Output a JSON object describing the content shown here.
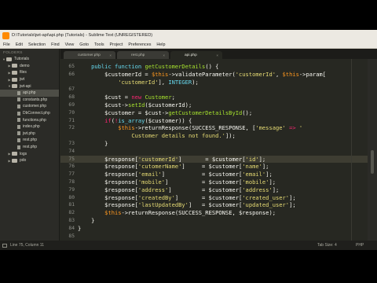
{
  "window": {
    "title": "D:\\Tutorials\\jwt-api\\api.php (Tutorials) - Sublime Text (UNREGISTERED)"
  },
  "menu": [
    "File",
    "Edit",
    "Selection",
    "Find",
    "View",
    "Goto",
    "Tools",
    "Project",
    "Preferences",
    "Help"
  ],
  "sidebar": {
    "header": "FOLDERS",
    "items": [
      {
        "label": "Tutorials",
        "type": "folder",
        "depth": 0,
        "arrow": "▼"
      },
      {
        "label": "demo",
        "type": "folder",
        "depth": 1,
        "arrow": "▶"
      },
      {
        "label": "files",
        "type": "folder",
        "depth": 1,
        "arrow": "▶"
      },
      {
        "label": "jwt",
        "type": "folder",
        "depth": 1,
        "arrow": "▶"
      },
      {
        "label": "jwt-api",
        "type": "folder",
        "depth": 1,
        "arrow": "▼"
      },
      {
        "label": "api.php",
        "type": "file",
        "depth": 2,
        "selected": true
      },
      {
        "label": "constants.php",
        "type": "file",
        "depth": 2
      },
      {
        "label": "customer.php",
        "type": "file",
        "depth": 2
      },
      {
        "label": "DbConnect.php",
        "type": "file",
        "depth": 2
      },
      {
        "label": "functions.php",
        "type": "file",
        "depth": 2
      },
      {
        "label": "index.php",
        "type": "file",
        "depth": 2
      },
      {
        "label": "jwt.php",
        "type": "file",
        "depth": 2
      },
      {
        "label": "rest.php",
        "type": "file",
        "depth": 2
      },
      {
        "label": "rest.php",
        "type": "file",
        "depth": 2
      },
      {
        "label": "logs",
        "type": "folder",
        "depth": 1,
        "arrow": "▶"
      },
      {
        "label": "pdo",
        "type": "folder",
        "depth": 1,
        "arrow": "▶"
      }
    ]
  },
  "tabs": [
    {
      "label": "customer.php",
      "active": false,
      "close": "×"
    },
    {
      "label": "rest.php",
      "active": false,
      "close": "×"
    },
    {
      "label": "api.php",
      "active": true,
      "close": "×"
    }
  ],
  "editor": {
    "colors": {
      "background": "#272822",
      "keyword": "#66d9ef",
      "storage": "#f92672",
      "function": "#a6e22e",
      "string": "#e6db74",
      "this": "#fd971f",
      "default": "#f8f8f2"
    },
    "lines": [
      {
        "n": "65",
        "tokens": [
          [
            "    ",
            "d"
          ],
          [
            "public",
            "k"
          ],
          [
            " ",
            "d"
          ],
          [
            "function",
            "k"
          ],
          [
            " ",
            "d"
          ],
          [
            "getCustomerDetails",
            "f"
          ],
          [
            "() {",
            "d"
          ]
        ]
      },
      {
        "n": "66",
        "tokens": [
          [
            "        $customerId = ",
            "d"
          ],
          [
            "$this",
            "t"
          ],
          [
            "->validateParameter(",
            "d"
          ],
          [
            "'customerId'",
            "s"
          ],
          [
            ", ",
            "d"
          ],
          [
            "$this",
            "t"
          ],
          [
            "->param[",
            "d"
          ]
        ]
      },
      {
        "n": "",
        "tokens": [
          [
            "            ",
            "d"
          ],
          [
            "'customerId'",
            "s"
          ],
          [
            "], ",
            "d"
          ],
          [
            "INTEGER",
            "k"
          ],
          [
            ");",
            "d"
          ]
        ]
      },
      {
        "n": "67",
        "tokens": []
      },
      {
        "n": "68",
        "tokens": [
          [
            "        $cust = ",
            "d"
          ],
          [
            "new",
            "p"
          ],
          [
            " ",
            "d"
          ],
          [
            "Customer",
            "f"
          ],
          [
            ";",
            "d"
          ]
        ]
      },
      {
        "n": "69",
        "tokens": [
          [
            "        $cust->",
            "d"
          ],
          [
            "setId",
            "f"
          ],
          [
            "($customerId);",
            "d"
          ]
        ]
      },
      {
        "n": "70",
        "tokens": [
          [
            "        $customer = $cust->",
            "d"
          ],
          [
            "getCustomerDetailsById",
            "f"
          ],
          [
            "();",
            "d"
          ]
        ]
      },
      {
        "n": "71",
        "tokens": [
          [
            "        ",
            "d"
          ],
          [
            "if",
            "p"
          ],
          [
            "(",
            "d"
          ],
          [
            "!",
            "p"
          ],
          [
            "is_array",
            "k"
          ],
          [
            "($customer)) {",
            "d"
          ]
        ]
      },
      {
        "n": "72",
        "tokens": [
          [
            "            ",
            "d"
          ],
          [
            "$this",
            "t"
          ],
          [
            "->returnResponse(SUCCESS_RESPONSE, [",
            "d"
          ],
          [
            "'message'",
            "s"
          ],
          [
            " => ",
            "p"
          ],
          [
            "'",
            "s"
          ]
        ]
      },
      {
        "n": "",
        "tokens": [
          [
            "                ",
            "d"
          ],
          [
            "Customer details not found.'",
            "s"
          ],
          [
            "]);",
            "d"
          ]
        ]
      },
      {
        "n": "73",
        "tokens": [
          [
            "        }",
            "d"
          ]
        ]
      },
      {
        "n": "74",
        "tokens": []
      },
      {
        "n": "75",
        "tokens": [
          [
            "        $response[",
            "d"
          ],
          [
            "'customerId'",
            "s"
          ],
          [
            "]       = $customer[",
            "d"
          ],
          [
            "'id'",
            "s"
          ],
          [
            "];",
            "d"
          ]
        ]
      },
      {
        "n": "76",
        "tokens": [
          [
            "        $response[",
            "d"
          ],
          [
            "'cutomerName'",
            "s"
          ],
          [
            "]     = $customer[",
            "d"
          ],
          [
            "'name'",
            "s"
          ],
          [
            "];",
            "d"
          ]
        ]
      },
      {
        "n": "77",
        "tokens": [
          [
            "        $response[",
            "d"
          ],
          [
            "'email'",
            "s"
          ],
          [
            "]           = $customer[",
            "d"
          ],
          [
            "'email'",
            "s"
          ],
          [
            "];",
            "d"
          ]
        ]
      },
      {
        "n": "78",
        "tokens": [
          [
            "        $response[",
            "d"
          ],
          [
            "'mobile'",
            "s"
          ],
          [
            "]          = $customer[",
            "d"
          ],
          [
            "'mobile'",
            "s"
          ],
          [
            "];",
            "d"
          ]
        ]
      },
      {
        "n": "79",
        "tokens": [
          [
            "        $response[",
            "d"
          ],
          [
            "'address'",
            "s"
          ],
          [
            "]         = $customer[",
            "d"
          ],
          [
            "'address'",
            "s"
          ],
          [
            "];",
            "d"
          ]
        ]
      },
      {
        "n": "80",
        "tokens": [
          [
            "        $response[",
            "d"
          ],
          [
            "'createdBy'",
            "s"
          ],
          [
            "]       = $customer[",
            "d"
          ],
          [
            "'created_user'",
            "s"
          ],
          [
            "];",
            "d"
          ]
        ]
      },
      {
        "n": "81",
        "tokens": [
          [
            "        $response[",
            "d"
          ],
          [
            "'lastUpdatedBy'",
            "s"
          ],
          [
            "]   = $customer[",
            "d"
          ],
          [
            "'updated_user'",
            "s"
          ],
          [
            "];",
            "d"
          ]
        ]
      },
      {
        "n": "82",
        "tokens": [
          [
            "        ",
            "d"
          ],
          [
            "$this",
            "t"
          ],
          [
            "->returnResponse(SUCCESS_RESPONSE, $response);",
            "d"
          ]
        ]
      },
      {
        "n": "83",
        "tokens": [
          [
            "    }",
            "d"
          ]
        ]
      },
      {
        "n": "84",
        "tokens": [
          [
            "}",
            "d"
          ]
        ]
      },
      {
        "n": "85",
        "tokens": []
      }
    ],
    "cursor_line_number": "75"
  },
  "status": {
    "position": "Line 75, Column 11",
    "tab_size": "Tab Size: 4",
    "syntax": "PHP"
  }
}
